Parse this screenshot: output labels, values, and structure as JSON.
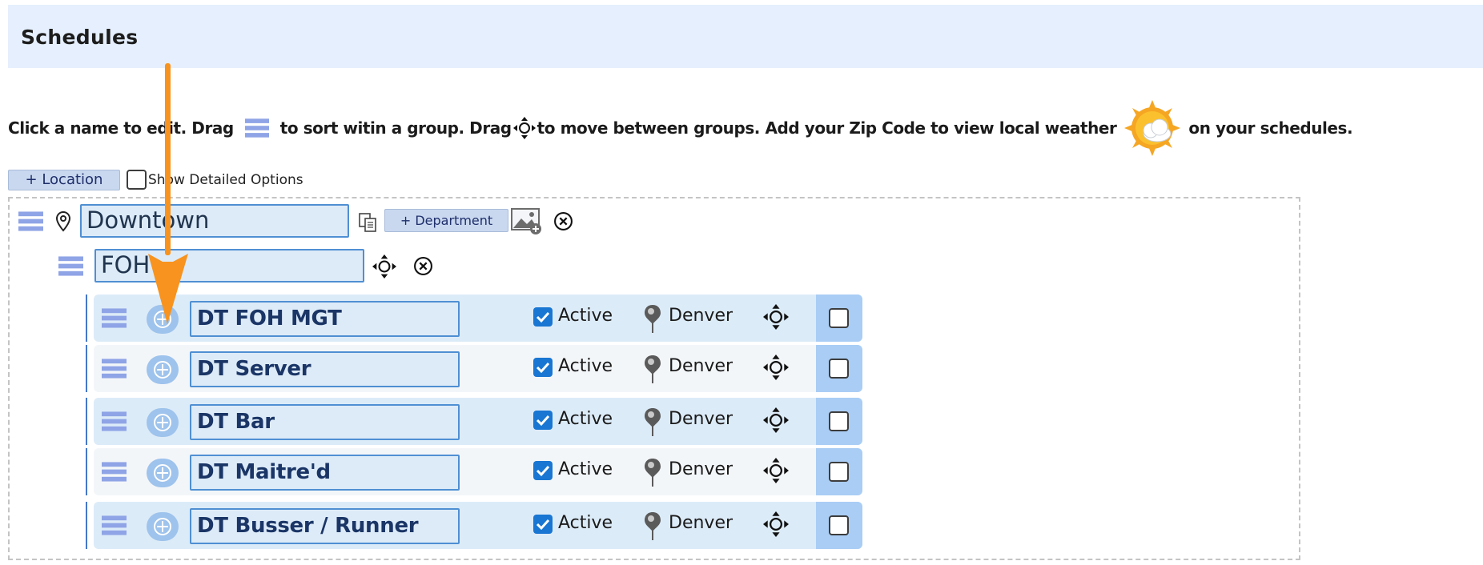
{
  "header": {
    "title": "Schedules"
  },
  "instructions": {
    "part1": "Click a name to edit. Drag",
    "part2": "to sort witin a group. Drag",
    "part3": "to move between groups. Add your Zip Code to view local weather",
    "part4": "on your schedules."
  },
  "toolbar": {
    "add_location_label": "+ Location",
    "show_options_label": "Show Detailed Options"
  },
  "location": {
    "name": "Downtown",
    "add_department_label": "+ Department"
  },
  "department": {
    "name": "FOH"
  },
  "schedules": [
    {
      "name": "DT FOH MGT",
      "status": "Active",
      "active": true,
      "city": "Denver"
    },
    {
      "name": "DT Server",
      "status": "Active",
      "active": true,
      "city": "Denver"
    },
    {
      "name": "DT Bar",
      "status": "Active",
      "active": true,
      "city": "Denver"
    },
    {
      "name": "DT Maitre'd",
      "status": "Active",
      "active": true,
      "city": "Denver"
    },
    {
      "name": "DT Busser / Runner",
      "status": "Active",
      "active": true,
      "city": "Denver"
    }
  ],
  "colors": {
    "header_bg": "#e5effd",
    "input_border": "#4f8fd3",
    "input_bg": "#ddebf8",
    "checkbox_blue": "#1976d2",
    "arrow_orange": "#f7931e"
  },
  "icons": {
    "drag": "drag-handle-icon",
    "move": "move-arrows-icon",
    "weather": "sun-cloud-icon",
    "pin": "location-pin-icon",
    "copy": "copy-icon",
    "image": "add-image-icon",
    "remove": "close-circle-icon",
    "add": "plus-circle-icon"
  }
}
